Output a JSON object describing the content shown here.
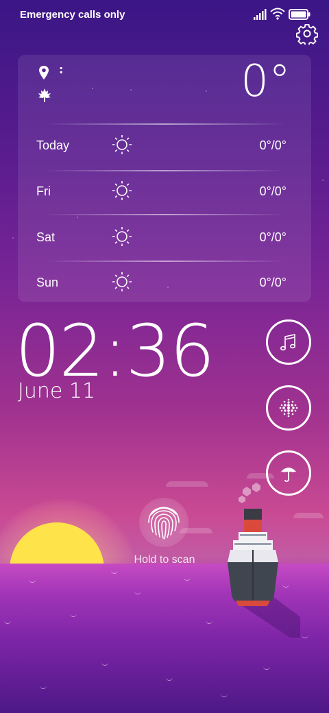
{
  "status_bar": {
    "carrier": "Emergency calls only",
    "icons": [
      "signal-icon",
      "wifi-icon",
      "battery-icon"
    ]
  },
  "settings": {
    "icon": "gear-icon"
  },
  "weather": {
    "location_text": ":",
    "current_temp": "0°",
    "forecast": [
      {
        "day": "Today",
        "icon": "sun-icon",
        "temp": "0°/0°"
      },
      {
        "day": "Fri",
        "icon": "sun-icon",
        "temp": "0°/0°"
      },
      {
        "day": "Sat",
        "icon": "sun-icon",
        "temp": "0°/0°"
      },
      {
        "day": "Sun",
        "icon": "sun-icon",
        "temp": "0°/0°"
      }
    ]
  },
  "clock": {
    "time": "02:36",
    "date": "June 11"
  },
  "shortcuts": [
    "music-note-icon",
    "dots-grid-icon",
    "umbrella-icon"
  ],
  "fingerprint": {
    "label": "Hold to scan"
  },
  "colors": {
    "sun": "#ffe34a",
    "sea": "#c64bc3",
    "sky_top": "#3b1686"
  }
}
